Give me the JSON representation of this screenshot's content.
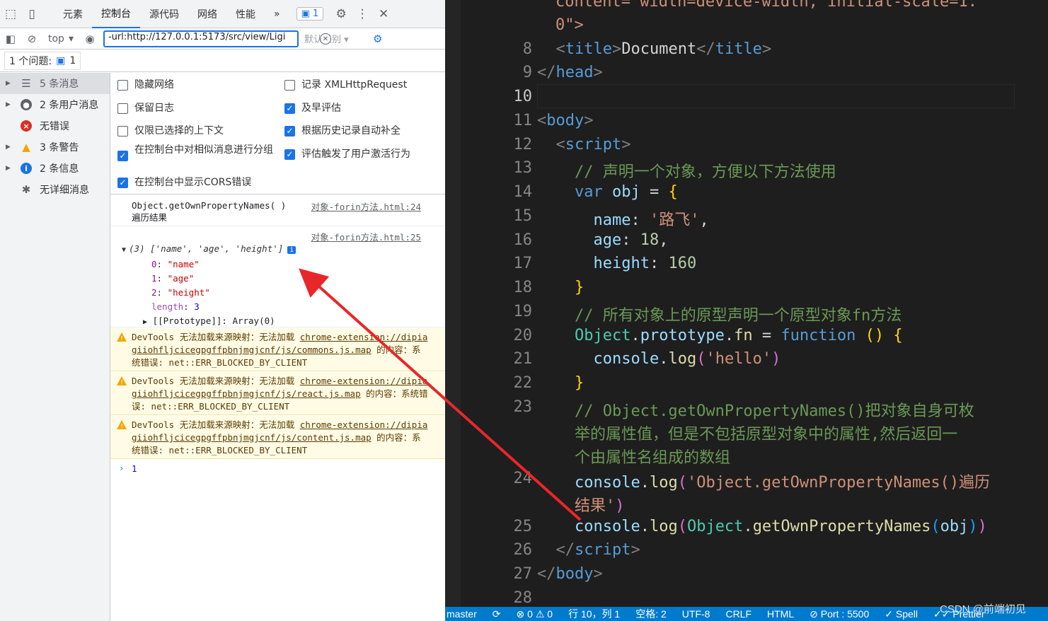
{
  "devtools": {
    "tabs": [
      "元素",
      "控制台",
      "源代码",
      "网络",
      "性能"
    ],
    "more": "»",
    "issue_count": "1",
    "context": "top",
    "filter_value": "-url:http://127.0.0.1:5173/src/view/Ligi",
    "level": "默认级别",
    "issues_label": "1 个问题:",
    "issues_count": "1"
  },
  "sidebar": {
    "items": [
      {
        "label": "5 条消息"
      },
      {
        "label": "2 条用户消息"
      },
      {
        "label": "无错误"
      },
      {
        "label": "3 条警告"
      },
      {
        "label": "2 条信息"
      },
      {
        "label": "无详细消息"
      }
    ]
  },
  "settings": {
    "left": [
      {
        "label": "隐藏网络",
        "checked": false
      },
      {
        "label": "保留日志",
        "checked": false
      },
      {
        "label": "仅限已选择的上下文",
        "checked": false
      },
      {
        "label": "在控制台中对相似消息进行分组",
        "checked": true
      },
      {
        "label": "在控制台中显示CORS错误",
        "checked": true
      }
    ],
    "right": [
      {
        "label": "记录 XMLHttpRequest",
        "checked": false
      },
      {
        "label": "及早评估",
        "checked": true
      },
      {
        "label": "根据历史记录自动补全",
        "checked": true
      },
      {
        "label": "评估触发了用户激活行为",
        "checked": true
      }
    ]
  },
  "console": {
    "log1_text": "Object.getOwnPropertyNames( )遍历结果",
    "log1_source": "对象-forin方法.html:24",
    "log2_source": "对象-forin方法.html:25",
    "array_summary": "(3) ['name', 'age', 'height']",
    "entries": [
      {
        "key": "0",
        "value": "\"name\""
      },
      {
        "key": "1",
        "value": "\"age\""
      },
      {
        "key": "2",
        "value": "\"height\""
      }
    ],
    "length_key": "length",
    "length_value": "3",
    "prototype": "[[Prototype]]: Array(0)",
    "warnings": [
      {
        "prefix": "DevTools 无法加载来源映射：无法加载 ",
        "link": "chrome-extension://dipiagiiohfljcicegpgffpbnjmgjcnf/js/commons.js.map",
        "suffix": " 的内容：系统错误: net::ERR_BLOCKED_BY_CLIENT"
      },
      {
        "prefix": "DevTools 无法加载来源映射：无法加载 ",
        "link": "chrome-extension://dipiagiiohfljcicegpgffpbnjmgjcnf/js/react.js.map",
        "suffix": " 的内容：系统错误: net::ERR_BLOCKED_BY_CLIENT"
      },
      {
        "prefix": "DevTools 无法加载来源映射：无法加载 ",
        "link": "chrome-extension://dipiagiiohfljcicegpgffpbnjmgjcnf/js/content.js.map",
        "suffix": " 的内容：系统错误: net::ERR_BLOCKED_BY_CLIENT"
      }
    ],
    "result": "1"
  },
  "editor": {
    "top_partial_1": "content=\"width=device-width, initial-scale=1.",
    "top_partial_2": "0\">",
    "comment_13": "// 声明一个对象，方便以下方法使用",
    "name_value": "'路飞'",
    "age_value": "18",
    "height_value": "160",
    "comment_19": "// 所有对象上的原型声明一个原型对象fn方法",
    "hello": "'hello'",
    "comment_23a": "// Object.getOwnPropertyNames()把对象自身可枚",
    "comment_23b": "举的属性值，但是不包括原型对象中的属性,然后返回一",
    "comment_23c": "个由属性名组成的数组",
    "log24a": "'Object.getOwnPropertyNames()遍历",
    "log24b": "结果'",
    "title_text": "Document"
  },
  "statusbar": {
    "branch": "master",
    "errors": "⊗ 0 ⚠ 0",
    "position": "行 10，列 1",
    "spaces": "空格: 2",
    "encoding": "UTF-8",
    "eol": "CRLF",
    "language": "HTML",
    "port": "⊘ Port : 5500",
    "spell": "✓ Spell",
    "prettier": "✓✓ Prettier"
  },
  "watermark": "CSDN @前端初见",
  "colors": {
    "accent": "#1a73e8",
    "statusbar": "#007acc",
    "arrow": "#e8272a"
  }
}
